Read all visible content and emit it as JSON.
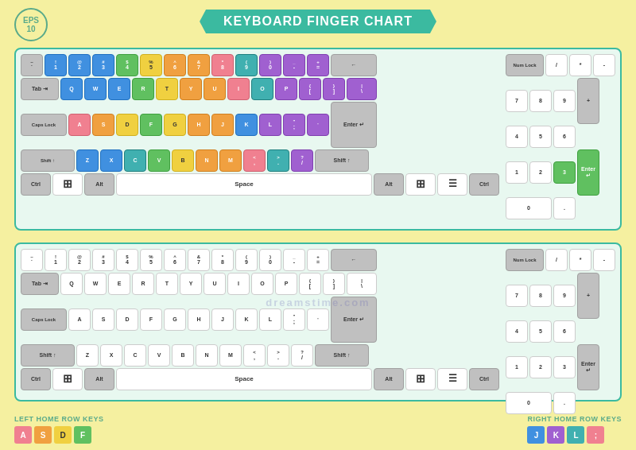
{
  "title": "KEYBOARD FINGER CHART",
  "eps": {
    "line1": "EPS",
    "line2": "10"
  },
  "legend": {
    "left_label": "LEFT HOME ROW KEYS",
    "right_label": "RIGHT HOME ROW KEYS",
    "left_keys": [
      {
        "letter": "A",
        "color": "#f08090"
      },
      {
        "letter": "S",
        "color": "#f0a040"
      },
      {
        "letter": "D",
        "color": "#f0d040"
      },
      {
        "letter": "F",
        "color": "#60c060"
      }
    ],
    "right_keys": [
      {
        "letter": "J",
        "color": "#4090e0"
      },
      {
        "letter": "K",
        "color": "#a060d0"
      },
      {
        "letter": "L",
        "color": "#40b0b0"
      },
      {
        "letter": ";",
        "color": "#f08090"
      }
    ]
  },
  "watermark": "dreamstime.com"
}
